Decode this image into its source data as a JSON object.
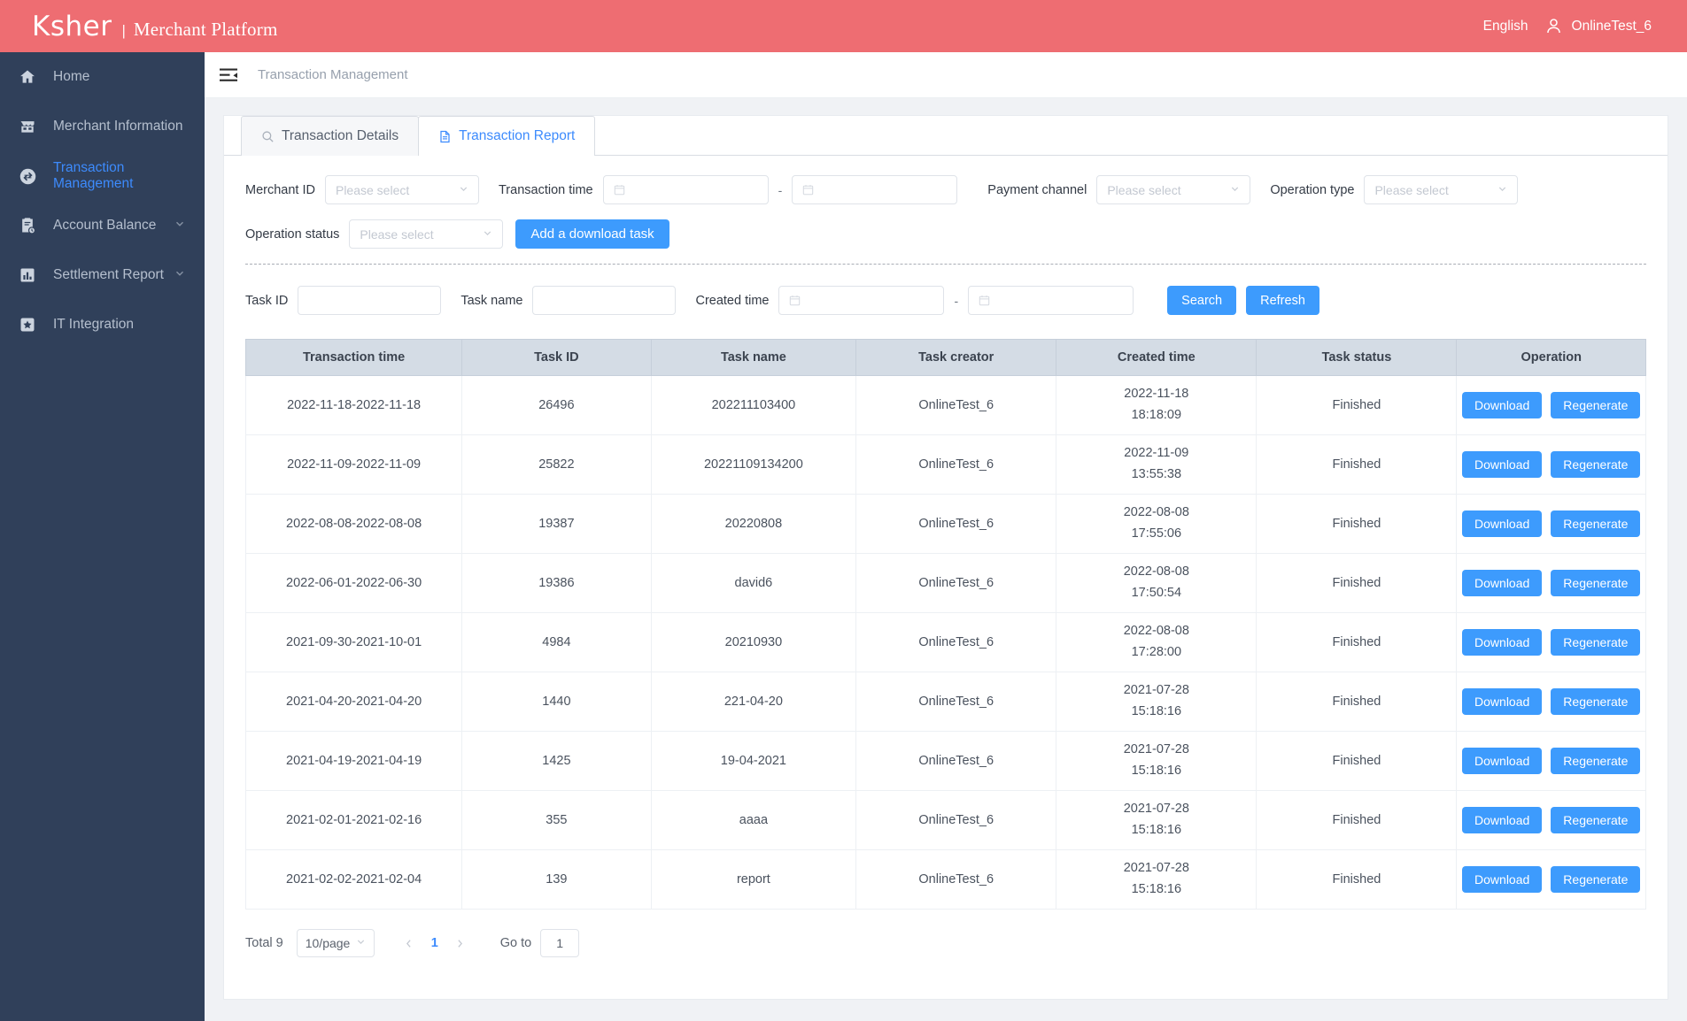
{
  "header": {
    "brand_logo": "Ksher",
    "brand_separator": "|",
    "brand_subtitle": "Merchant Platform",
    "language": "English",
    "username": "OnlineTest_6",
    "bg_color": "#ee6d72"
  },
  "sidebar": {
    "bg_color": "#30405a",
    "active_color": "#3d8bfd",
    "items": [
      {
        "label": "Home",
        "icon": "home-icon",
        "active": false,
        "expandable": false
      },
      {
        "label": "Merchant Information",
        "icon": "store-icon",
        "active": false,
        "expandable": false
      },
      {
        "label": "Transaction Management",
        "icon": "transfer-icon",
        "active": true,
        "expandable": false
      },
      {
        "label": "Account Balance",
        "icon": "clipboard-clock-icon",
        "active": false,
        "expandable": true
      },
      {
        "label": "Settlement Report",
        "icon": "bar-chart-icon",
        "active": false,
        "expandable": true
      },
      {
        "label": "IT Integration",
        "icon": "star-box-icon",
        "active": false,
        "expandable": false
      }
    ]
  },
  "breadcrumb": {
    "collapse_icon": "menu-fold-icon",
    "text": "Transaction Management"
  },
  "tabs": [
    {
      "label": "Transaction Details",
      "icon": "search-icon",
      "active": false
    },
    {
      "label": "Transaction Report",
      "icon": "document-icon",
      "active": true
    }
  ],
  "filters": {
    "merchant_id": {
      "label": "Merchant ID",
      "placeholder": "Please select",
      "value": ""
    },
    "transaction_time": {
      "label": "Transaction time",
      "start_placeholder": "",
      "start_value": "",
      "separator": "-",
      "end_placeholder": "",
      "end_value": ""
    },
    "payment_channel": {
      "label": "Payment channel",
      "placeholder": "Please select",
      "value": ""
    },
    "operation_type": {
      "label": "Operation type",
      "placeholder": "Please select",
      "value": ""
    },
    "operation_status": {
      "label": "Operation status",
      "placeholder": "Please select",
      "value": ""
    },
    "add_download_task_label": "Add a download task"
  },
  "search": {
    "task_id": {
      "label": "Task ID",
      "placeholder": "",
      "value": ""
    },
    "task_name": {
      "label": "Task name",
      "placeholder": "",
      "value": ""
    },
    "created_time": {
      "label": "Created time",
      "start_placeholder": "",
      "start_value": "",
      "separator": "-",
      "end_placeholder": "",
      "end_value": ""
    },
    "search_label": "Search",
    "refresh_label": "Refresh"
  },
  "table": {
    "columns": [
      "Transaction time",
      "Task ID",
      "Task name",
      "Task creator",
      "Created time",
      "Task status",
      "Operation"
    ],
    "op_download_label": "Download",
    "op_regenerate_label": "Regenerate",
    "rows": [
      {
        "transaction_time": "2022-11-18-2022-11-18",
        "task_id": "26496",
        "task_name": "202211103400",
        "task_creator": "OnlineTest_6",
        "created_date": "2022-11-18",
        "created_clock": "18:18:09",
        "task_status": "Finished"
      },
      {
        "transaction_time": "2022-11-09-2022-11-09",
        "task_id": "25822",
        "task_name": "20221109134200",
        "task_creator": "OnlineTest_6",
        "created_date": "2022-11-09",
        "created_clock": "13:55:38",
        "task_status": "Finished"
      },
      {
        "transaction_time": "2022-08-08-2022-08-08",
        "task_id": "19387",
        "task_name": "20220808",
        "task_creator": "OnlineTest_6",
        "created_date": "2022-08-08",
        "created_clock": "17:55:06",
        "task_status": "Finished"
      },
      {
        "transaction_time": "2022-06-01-2022-06-30",
        "task_id": "19386",
        "task_name": "david6",
        "task_creator": "OnlineTest_6",
        "created_date": "2022-08-08",
        "created_clock": "17:50:54",
        "task_status": "Finished"
      },
      {
        "transaction_time": "2021-09-30-2021-10-01",
        "task_id": "4984",
        "task_name": "20210930",
        "task_creator": "OnlineTest_6",
        "created_date": "2022-08-08",
        "created_clock": "17:28:00",
        "task_status": "Finished"
      },
      {
        "transaction_time": "2021-04-20-2021-04-20",
        "task_id": "1440",
        "task_name": "221-04-20",
        "task_creator": "OnlineTest_6",
        "created_date": "2021-07-28",
        "created_clock": "15:18:16",
        "task_status": "Finished"
      },
      {
        "transaction_time": "2021-04-19-2021-04-19",
        "task_id": "1425",
        "task_name": "19-04-2021",
        "task_creator": "OnlineTest_6",
        "created_date": "2021-07-28",
        "created_clock": "15:18:16",
        "task_status": "Finished"
      },
      {
        "transaction_time": "2021-02-01-2021-02-16",
        "task_id": "355",
        "task_name": "aaaa",
        "task_creator": "OnlineTest_6",
        "created_date": "2021-07-28",
        "created_clock": "15:18:16",
        "task_status": "Finished"
      },
      {
        "transaction_time": "2021-02-02-2021-02-04",
        "task_id": "139",
        "task_name": "report",
        "task_creator": "OnlineTest_6",
        "created_date": "2021-07-28",
        "created_clock": "15:18:16",
        "task_status": "Finished"
      }
    ]
  },
  "pagination": {
    "total_text": "Total 9",
    "page_size": "10/page",
    "prev_icon": "chevron-left-icon",
    "next_icon": "chevron-right-icon",
    "current_page": "1",
    "goto_label": "Go to",
    "goto_value": "1"
  },
  "colors": {
    "accent_blue": "#3d9bfd",
    "header_coral": "#ee6d72",
    "sidebar_navy": "#30405a",
    "table_header": "#d4dce5"
  }
}
